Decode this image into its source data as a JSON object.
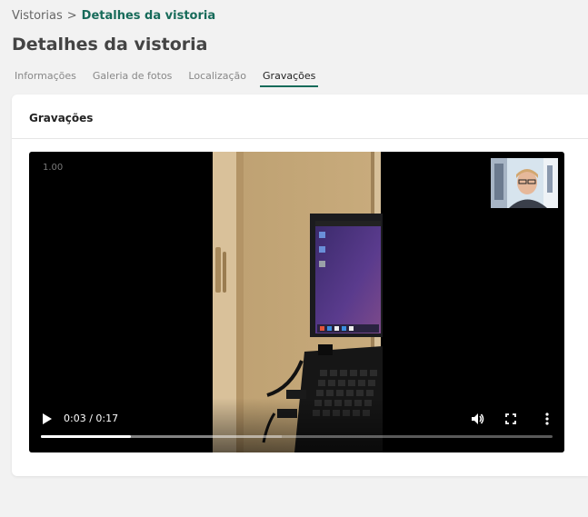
{
  "breadcrumb": {
    "parent": "Vistorias",
    "separator": ">",
    "current": "Detalhes da vistoria"
  },
  "page": {
    "title": "Detalhes da vistoria"
  },
  "tabs": [
    {
      "label": "Informações",
      "active": false
    },
    {
      "label": "Galeria de fotos",
      "active": false
    },
    {
      "label": "Localização",
      "active": false
    },
    {
      "label": "Gravações",
      "active": true
    }
  ],
  "card": {
    "title": "Gravações"
  },
  "video": {
    "overlay_text": "1.00",
    "time_display": "0:03 / 0:17",
    "played_fraction": 0.1765,
    "buffered_fraction": 0.47,
    "icons": [
      "play-icon",
      "volume-icon",
      "fullscreen-icon",
      "more-options-icon"
    ]
  },
  "colors": {
    "accent": "#176b5a",
    "page_background": "#f2f2f2",
    "card_background": "#ffffff",
    "video_background": "#000000"
  }
}
